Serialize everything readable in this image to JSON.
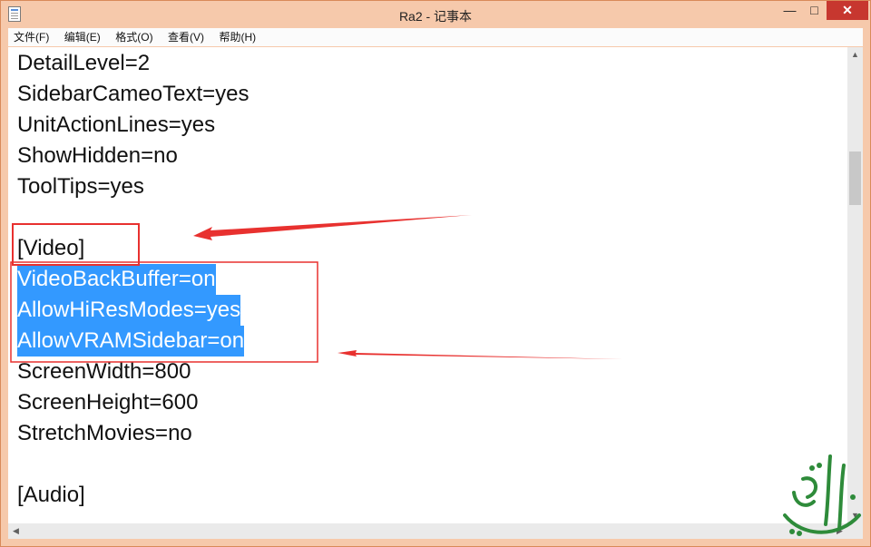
{
  "window": {
    "title": "Ra2 - 记事本",
    "minimize_glyph": "—",
    "maximize_glyph": "□",
    "close_glyph": "✕"
  },
  "menu": {
    "items": [
      {
        "label": "文件(F)"
      },
      {
        "label": "编辑(E)"
      },
      {
        "label": "格式(O)"
      },
      {
        "label": "查看(V)"
      },
      {
        "label": "帮助(H)"
      }
    ]
  },
  "editor": {
    "lines": [
      {
        "text": "DetailLevel=2",
        "selected": false
      },
      {
        "text": "SidebarCameoText=yes",
        "selected": false
      },
      {
        "text": "UnitActionLines=yes",
        "selected": false
      },
      {
        "text": "ShowHidden=no",
        "selected": false
      },
      {
        "text": "ToolTips=yes",
        "selected": false
      },
      {
        "text": "",
        "selected": false
      },
      {
        "text": "[Video]",
        "selected": false
      },
      {
        "text": "VideoBackBuffer=on",
        "selected": true
      },
      {
        "text": "AllowHiResModes=yes",
        "selected": true
      },
      {
        "text": "AllowVRAMSidebar=on",
        "selected": true
      },
      {
        "text": "ScreenWidth=800",
        "selected": false
      },
      {
        "text": "ScreenHeight=600",
        "selected": false
      },
      {
        "text": "StretchMovies=no",
        "selected": false
      },
      {
        "text": "",
        "selected": false
      },
      {
        "text": "[Audio]",
        "selected": false
      }
    ],
    "selection_color": "#3399ff"
  },
  "scrollbar": {
    "up_glyph": "▲",
    "down_glyph": "▼",
    "left_glyph": "◀",
    "right_glyph": "▶"
  },
  "annotations": {
    "color": "#e8312f",
    "items": [
      {
        "kind": "box",
        "target": "[Video]"
      },
      {
        "kind": "arrow",
        "target": "[Video]"
      },
      {
        "kind": "box",
        "target": "selected-lines"
      },
      {
        "kind": "arrow",
        "target": "selected-lines"
      }
    ]
  },
  "icons": {
    "app": "notepad-icon",
    "watermark": "arabic-calligraphy-logo"
  }
}
